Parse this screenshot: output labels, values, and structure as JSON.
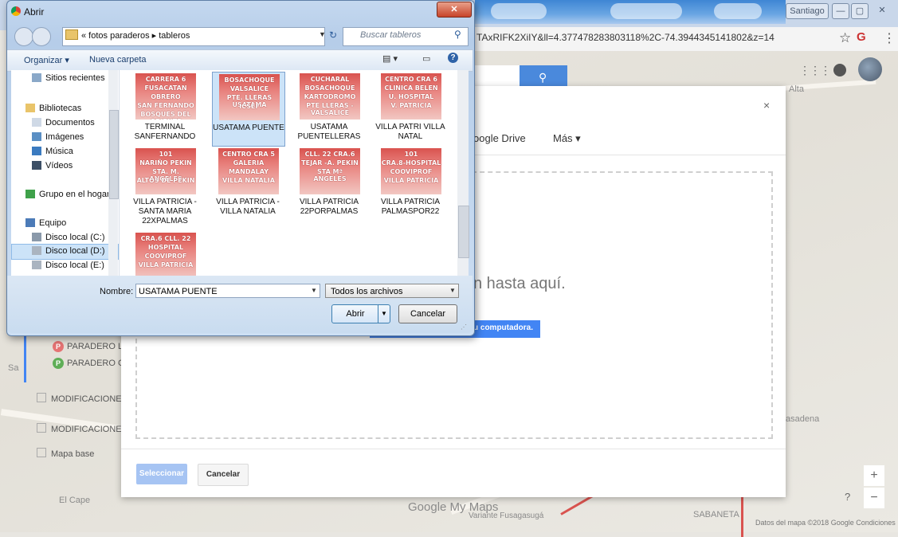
{
  "browser": {
    "tab_area": "",
    "url": "TAxRIFK2XiIY&ll=4.377478283803118%2C-74.3944345141802&z=14",
    "user_name": "Santiago",
    "win_min": "—",
    "win_max": "▢",
    "win_close": "✕",
    "star": "☆",
    "menu": "⋮"
  },
  "map": {
    "labels": {
      "alta": "Alta",
      "pasadena": "asadena",
      "el_cape": "El Cape",
      "sabaneta": "SABANETA",
      "variante": "Variante Fusagasugá",
      "sa": "Sa"
    },
    "logo": "Google My Maps",
    "attribution": "Datos del mapa ©2018 Google   Condiciones",
    "zoom_in": "+",
    "zoom_out": "−",
    "help": "?",
    "layers": [
      {
        "type": "pin",
        "badge": "P",
        "label": "PARADERO L"
      },
      {
        "type": "pin",
        "badge": "P",
        "label": "PARADERO G"
      },
      {
        "type": "check",
        "label": "MODIFICACIONE"
      },
      {
        "type": "check",
        "label": "MODIFICACIONE"
      },
      {
        "type": "base",
        "label": "Mapa base"
      }
    ]
  },
  "upload_dialog": {
    "close": "×",
    "tab_drive": "oogle Drive",
    "tab_more": "Más ▾",
    "drop_text": "n hasta aquí.",
    "upload_button": "u computadora.",
    "select_button": "Seleccionar",
    "cancel_button": "Cancelar"
  },
  "file_dialog": {
    "title": "Abrir",
    "breadcrumb": "« fotos paraderos ▸ tableros",
    "search_placeholder": "Buscar tableros",
    "toolbar": {
      "organize": "Organizar ▾",
      "new_folder": "Nueva carpeta"
    },
    "nav": [
      {
        "label": "Sitios recientes",
        "icon": "recent-icon",
        "color": "#8aa8c8"
      },
      {
        "label": "Bibliotecas",
        "icon": "library-icon",
        "color": "#e9c46a"
      },
      {
        "label": "Documentos",
        "icon": "documents-icon",
        "color": "#cfd9e6"
      },
      {
        "label": "Imágenes",
        "icon": "pictures-icon",
        "color": "#5a8fc4"
      },
      {
        "label": "Música",
        "icon": "music-icon",
        "color": "#3b7bc0"
      },
      {
        "label": "Vídeos",
        "icon": "videos-icon",
        "color": "#3c4f66"
      },
      {
        "label": "Grupo en el hogar",
        "icon": "homegroup-icon",
        "color": "#3fa14a"
      },
      {
        "label": "Equipo",
        "icon": "computer-icon",
        "color": "#4c7bb8"
      },
      {
        "label": "Disco local (C:)",
        "icon": "drive-c-icon",
        "color": "#8a99aa"
      },
      {
        "label": "Disco local (D:)",
        "icon": "drive-d-icon",
        "color": "#aab4c0"
      },
      {
        "label": "Disco local (E:)",
        "icon": "drive-e-icon",
        "color": "#aab4c0"
      }
    ],
    "files": [
      {
        "label": "TERMINAL SANFERNANDO",
        "thumb": [
          "CARRERA 6",
          "FUSACATAN",
          "OBRERO",
          "SAN FERNANDO",
          "BOSQUES DEL ORIENTE"
        ]
      },
      {
        "label": "USATAMA PUENTE",
        "thumb": [
          "BOSACHOQUE",
          "VALSALICE",
          "PTE. LLERAS USATAMA",
          "ICSEF"
        ]
      },
      {
        "label": "USATAMA PUENTELLERAS",
        "thumb": [
          "CUCHARAL",
          "BOSACHOQUE",
          "KARTODROMO",
          "PTE LLERAS - VALSALICE"
        ]
      },
      {
        "label": "VILLA PATRI VILLA NATAL",
        "thumb": [
          "CENTRO CRA 6",
          "CLINICA BELEN",
          "U. HOSPITAL",
          "V. PATRICIA"
        ]
      },
      {
        "label": "VILLA PATRICIA - SANTA MARIA 22XPALMAS",
        "thumb": [
          "101",
          "NARIÑO PEKIN",
          "STA. M. ANGELES",
          "ALTOS DE PEKIN"
        ]
      },
      {
        "label": "VILLA PATRICIA - VILLA NATALIA",
        "thumb": [
          "CENTRO CRA 5",
          "GALERIA",
          "MANDALAY",
          "VILLA NATALIA"
        ]
      },
      {
        "label": "VILLA PATRICIA 22PORPALMAS",
        "thumb": [
          "CLL. 22 CRA.6",
          "TEJAR -A. PEKIN",
          "STA Mª ANGELES"
        ]
      },
      {
        "label": "VILLA PATRICIA PALMASPOR22",
        "thumb": [
          "101",
          "CRA.8-HOSPITAL",
          "COOVIPROF",
          "VILLA PATRICIA"
        ]
      },
      {
        "label": "",
        "thumb": [
          "CRA.6 CLL. 22",
          "HOSPITAL",
          "COOVIPROF",
          "VILLA PATRICIA"
        ]
      }
    ],
    "name_label": "Nombre:",
    "name_value": "USATAMA PUENTE",
    "filter_value": "Todos los archivos",
    "open_button": "Abrir",
    "cancel_button": "Cancelar"
  }
}
